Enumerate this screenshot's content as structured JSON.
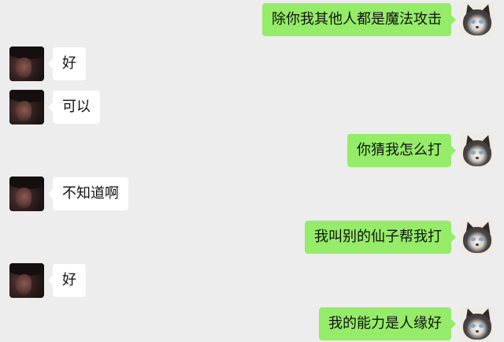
{
  "chat": {
    "messages": [
      {
        "side": "right",
        "text": "除你我其他人都是魔法攻击"
      },
      {
        "side": "left",
        "text": "好"
      },
      {
        "side": "left",
        "text": "可以"
      },
      {
        "side": "right",
        "text": "你猜我怎么打"
      },
      {
        "side": "left",
        "text": "不知道啊"
      },
      {
        "side": "right",
        "text": "我叫别的仙子帮我打"
      },
      {
        "side": "left",
        "text": "好"
      },
      {
        "side": "right",
        "text": "我的能力是人缘好"
      }
    ]
  },
  "colors": {
    "background": "#ededed",
    "sent_bubble": "#95ec69",
    "received_bubble": "#ffffff",
    "text": "#111111"
  },
  "icons": {
    "sender_avatar": "cat-avatar",
    "receiver_avatar": "girl-avatar"
  }
}
